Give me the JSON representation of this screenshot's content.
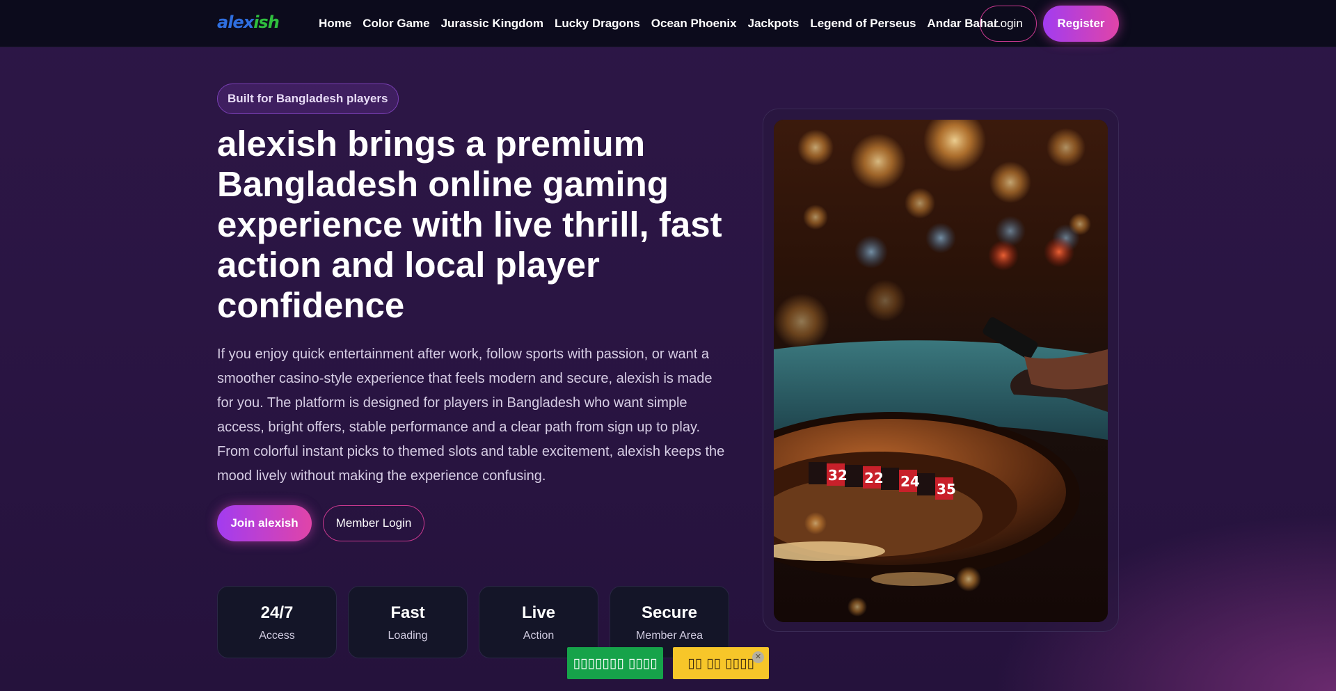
{
  "header": {
    "logo": {
      "part1": "alex",
      "part2": "ish"
    },
    "nav": [
      "Home",
      "Color Game",
      "Jurassic Kingdom",
      "Lucky Dragons",
      "Ocean Phoenix",
      "Jackpots",
      "Legend of Perseus",
      "Andar Bahar"
    ],
    "login_label": "Login",
    "register_label": "Register"
  },
  "hero": {
    "badge": "Built for Bangladesh players",
    "title": "alexish brings a premium Bangladesh online gaming experience with live thrill, fast action and local player confidence",
    "description": "If you enjoy quick entertainment after work, follow sports with passion, or want a smoother casino-style experience that feels modern and secure, alexish is made for you. The platform is designed for players in Bangladesh who want simple access, bright offers, stable performance and a clear path from sign up to play. From colorful instant picks to themed slots and table excitement, alexish keeps the mood lively without making the experience confusing.",
    "primary_button": "Join alexish",
    "secondary_button": "Member Login"
  },
  "stats": [
    {
      "value": "24/7",
      "label": "Access"
    },
    {
      "value": "Fast",
      "label": "Loading"
    },
    {
      "value": "Live",
      "label": "Action"
    },
    {
      "value": "Secure",
      "label": "Member Area"
    }
  ],
  "floating": {
    "green_label": "▯▯▯▯▯▯▯ ▯▯▯▯",
    "yellow_label": "▯▯ ▯▯ ▯▯▯▯",
    "close_icon": "close-icon"
  },
  "colors": {
    "accent_start": "#a23cf0",
    "accent_end": "#e044a8",
    "outline": "#c8388f",
    "green": "#16a34a",
    "yellow": "#f7c629"
  }
}
